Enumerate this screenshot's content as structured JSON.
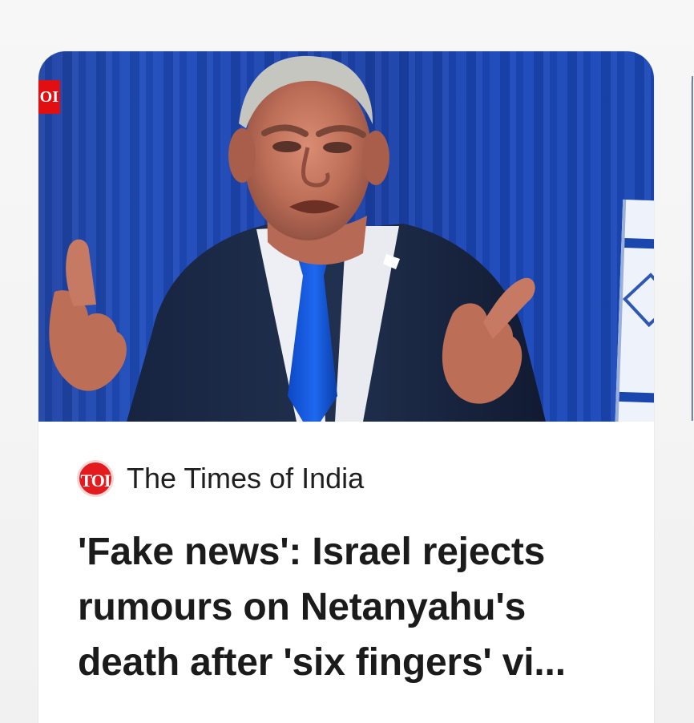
{
  "media": {
    "corner_badge": "OI"
  },
  "source": {
    "logo_text": "TOI",
    "name": "The Times of India"
  },
  "article": {
    "headline": "'Fake news': Israel rejects rumours on Netanyahu's death after 'six fingers' vi..."
  },
  "colors": {
    "brand_red": "#e31b1f",
    "curtain_blue": "#1f4dbd",
    "headline_text": "#1b1b1b"
  },
  "icons": {
    "source_logo": "times-of-india-logo",
    "corner_badge": "times-of-india-badge"
  }
}
